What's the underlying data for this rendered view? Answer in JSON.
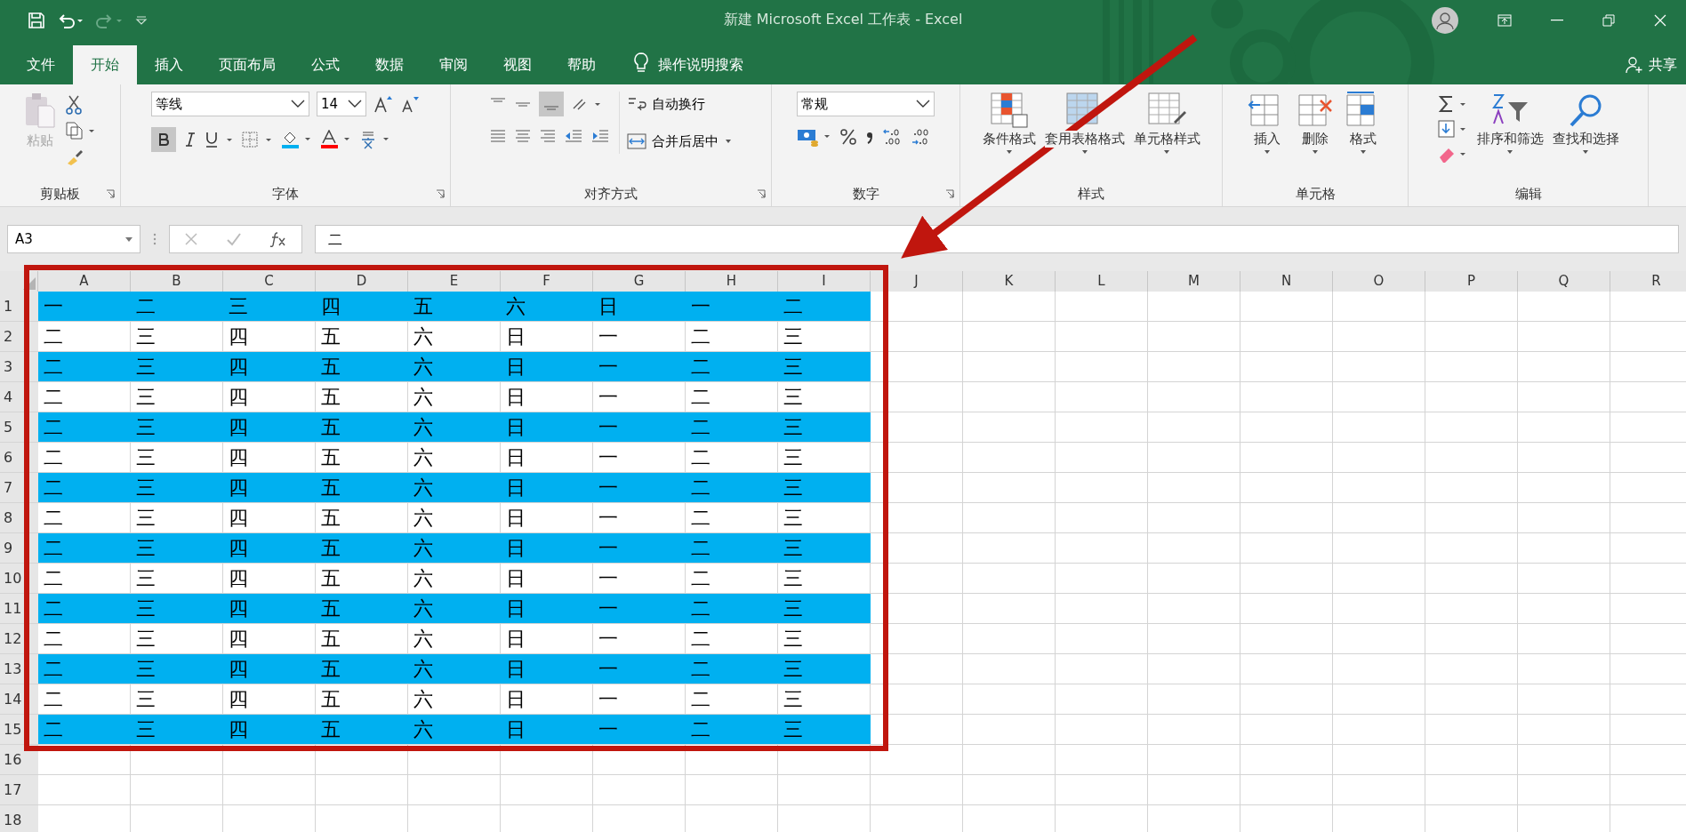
{
  "window": {
    "title": "新建 Microsoft Excel 工作表  -  Excel"
  },
  "tabs": [
    {
      "label": "文件",
      "selected": false
    },
    {
      "label": "开始",
      "selected": true
    },
    {
      "label": "插入",
      "selected": false
    },
    {
      "label": "页面布局",
      "selected": false
    },
    {
      "label": "公式",
      "selected": false
    },
    {
      "label": "数据",
      "selected": false
    },
    {
      "label": "审阅",
      "selected": false
    },
    {
      "label": "视图",
      "selected": false
    },
    {
      "label": "帮助",
      "selected": false
    }
  ],
  "tell_me": "操作说明搜索",
  "share": "共享",
  "ribbon": {
    "groups": [
      {
        "kind": "clipboard",
        "label": "剪贴板",
        "paste": "粘贴",
        "paste_disabled": true
      },
      {
        "kind": "font",
        "label": "字体",
        "font_name": "等线",
        "font_size": "14",
        "bold": true
      },
      {
        "kind": "alignment",
        "label": "对齐方式",
        "bottom_align": true,
        "wrap": "自动换行",
        "merge": "合并后居中"
      },
      {
        "kind": "number",
        "label": "数字",
        "format": "常规"
      },
      {
        "kind": "styles",
        "label": "样式",
        "buttons": [
          "条件格式",
          "套用表格格式",
          "单元格样式"
        ]
      },
      {
        "kind": "cells",
        "label": "单元格",
        "buttons": [
          "插入",
          "删除",
          "格式"
        ]
      },
      {
        "kind": "editing",
        "label": "编辑",
        "buttons": [
          "排序和筛选",
          "查找和选择"
        ]
      }
    ]
  },
  "formula_bar": {
    "name_box": "A3",
    "value": "二"
  },
  "sheet": {
    "columns": [
      "A",
      "B",
      "C",
      "D",
      "E",
      "F",
      "G",
      "H",
      "I",
      "J",
      "K",
      "L",
      "M",
      "N",
      "O",
      "P",
      "Q",
      "R"
    ],
    "rows": [
      {
        "header": "1",
        "filled": true,
        "cells": [
          "一",
          "二",
          "三",
          "四",
          "五",
          "六",
          "日",
          "一",
          "二"
        ]
      },
      {
        "header": "2",
        "filled": false,
        "cells": [
          "二",
          "三",
          "四",
          "五",
          "六",
          "日",
          "一",
          "二",
          "三"
        ]
      },
      {
        "header": "3",
        "filled": true,
        "cells": [
          "二",
          "三",
          "四",
          "五",
          "六",
          "日",
          "一",
          "二",
          "三"
        ]
      },
      {
        "header": "4",
        "filled": false,
        "cells": [
          "二",
          "三",
          "四",
          "五",
          "六",
          "日",
          "一",
          "二",
          "三"
        ]
      },
      {
        "header": "5",
        "filled": true,
        "cells": [
          "二",
          "三",
          "四",
          "五",
          "六",
          "日",
          "一",
          "二",
          "三"
        ]
      },
      {
        "header": "6",
        "filled": false,
        "cells": [
          "二",
          "三",
          "四",
          "五",
          "六",
          "日",
          "一",
          "二",
          "三"
        ]
      },
      {
        "header": "7",
        "filled": true,
        "cells": [
          "二",
          "三",
          "四",
          "五",
          "六",
          "日",
          "一",
          "二",
          "三"
        ]
      },
      {
        "header": "8",
        "filled": false,
        "cells": [
          "二",
          "三",
          "四",
          "五",
          "六",
          "日",
          "一",
          "二",
          "三"
        ]
      },
      {
        "header": "9",
        "filled": true,
        "cells": [
          "二",
          "三",
          "四",
          "五",
          "六",
          "日",
          "一",
          "二",
          "三"
        ]
      },
      {
        "header": "10",
        "filled": false,
        "cells": [
          "二",
          "三",
          "四",
          "五",
          "六",
          "日",
          "一",
          "二",
          "三"
        ]
      },
      {
        "header": "11",
        "filled": true,
        "cells": [
          "二",
          "三",
          "四",
          "五",
          "六",
          "日",
          "一",
          "二",
          "三"
        ]
      },
      {
        "header": "12",
        "filled": false,
        "cells": [
          "二",
          "三",
          "四",
          "五",
          "六",
          "日",
          "一",
          "二",
          "三"
        ]
      },
      {
        "header": "13",
        "filled": true,
        "cells": [
          "二",
          "三",
          "四",
          "五",
          "六",
          "日",
          "一",
          "二",
          "三"
        ]
      },
      {
        "header": "14",
        "filled": false,
        "cells": [
          "二",
          "三",
          "四",
          "五",
          "六",
          "日",
          "一",
          "二",
          "三"
        ]
      },
      {
        "header": "15",
        "filled": true,
        "cells": [
          "二",
          "三",
          "四",
          "五",
          "六",
          "日",
          "一",
          "二",
          "三"
        ]
      },
      {
        "header": "16",
        "filled": false,
        "cells": []
      },
      {
        "header": "17",
        "filled": false,
        "cells": []
      },
      {
        "header": "18",
        "filled": false,
        "cells": []
      }
    ]
  }
}
